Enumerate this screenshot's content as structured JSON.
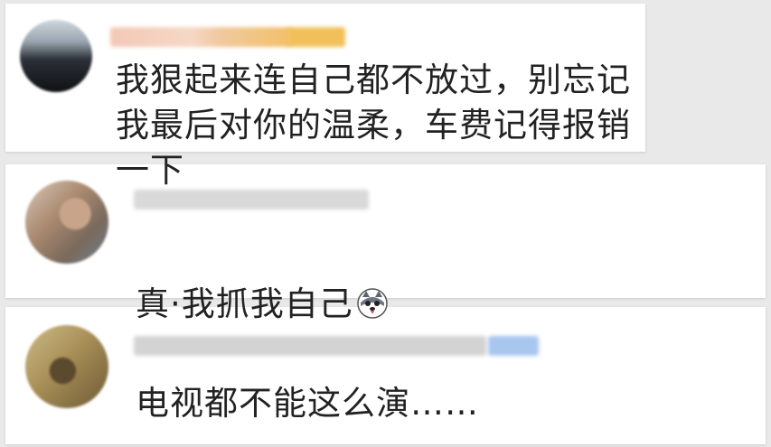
{
  "comments": [
    {
      "text": "我狠起来连自己都不放过，别忘记我最后对你的温柔，车费记得报销一下"
    },
    {
      "text": "真·我抓我自己",
      "emoji": "husky-face-emoji"
    },
    {
      "text": "电视都不能这么演……"
    }
  ]
}
